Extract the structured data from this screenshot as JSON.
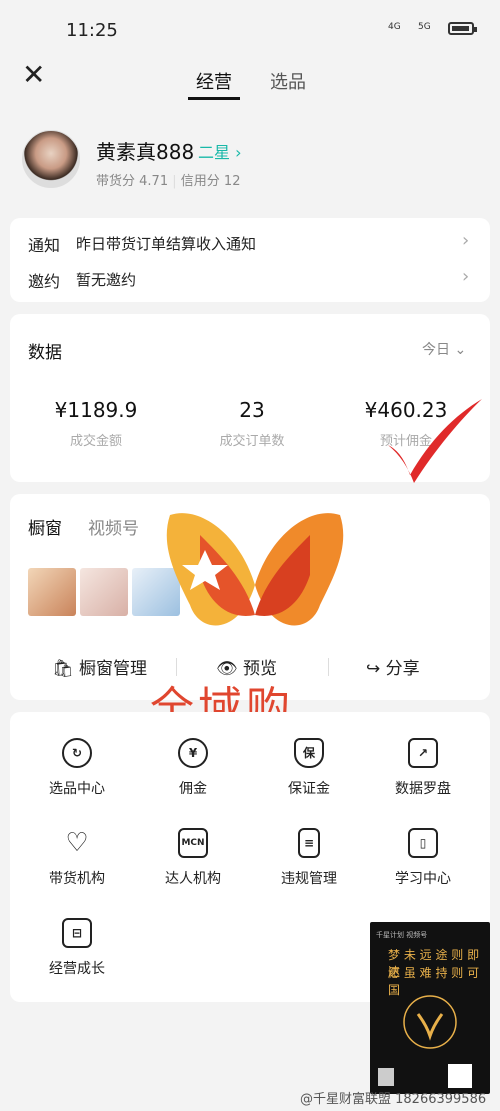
{
  "status": {
    "time": "11:25",
    "signal1": "4G",
    "signal2": "5G"
  },
  "tabs": [
    {
      "label": "经营"
    },
    {
      "label": "选品"
    }
  ],
  "profile": {
    "name": "黄素真888",
    "level": "二星",
    "sub_prefix": "带货分",
    "sub_score1": "4.71",
    "sub_mid": "信用分",
    "sub_score2": "12"
  },
  "notice": {
    "k1": "通知",
    "v1": "昨日带货订单结算收入通知",
    "k2": "邀约",
    "v2": "暂无邀约"
  },
  "data_section": {
    "title": "数据",
    "period": "今日",
    "metrics": [
      {
        "value": "¥1189.9",
        "label": "成交金额"
      },
      {
        "value": "23",
        "label": "成交订单数"
      },
      {
        "value": "¥460.23",
        "label": "预计佣金"
      }
    ]
  },
  "window": {
    "tab1": "橱窗",
    "tab2": "视频号",
    "partial": "讠",
    "actions": [
      {
        "label": "橱窗管理"
      },
      {
        "label": "预览"
      },
      {
        "label": "分享"
      }
    ]
  },
  "overlay_text": "全域购",
  "tools": [
    {
      "label": "选品中心",
      "icon": "selection-icon",
      "glyph": "↻"
    },
    {
      "label": "佣金",
      "icon": "yen-icon",
      "glyph": "¥"
    },
    {
      "label": "保证金",
      "icon": "shield-icon",
      "glyph": "保"
    },
    {
      "label": "数据罗盘",
      "icon": "chart-icon",
      "glyph": "↗"
    },
    {
      "label": "带货机构",
      "icon": "heart-handshake-icon",
      "glyph": "♡"
    },
    {
      "label": "达人机构",
      "icon": "mcn-icon",
      "glyph": "MCN"
    },
    {
      "label": "违规管理",
      "icon": "document-icon",
      "glyph": "≡"
    },
    {
      "label": "学习中心",
      "icon": "map-icon",
      "glyph": "▯"
    },
    {
      "label": "经营成长",
      "icon": "book-icon",
      "glyph": "⊟"
    }
  ],
  "poster": {
    "top": "千星计划 视频号",
    "line1": "梦 未 远 途 则 即 达",
    "line2": "愿 虽 难 持 则 可 国"
  },
  "watermark": "@千星财富联盟 18266399586",
  "colors": {
    "accent": "#18b8a8",
    "overlay_red": "#e0462f",
    "check_red": "#e02a2a"
  }
}
